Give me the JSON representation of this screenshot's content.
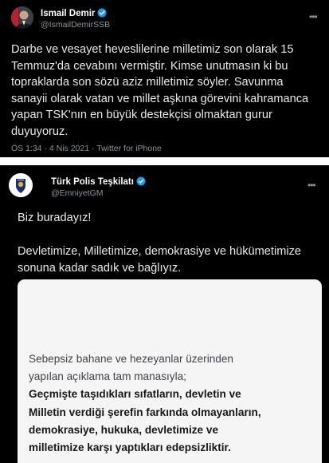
{
  "tweet1": {
    "author_name": "Ismail Demir",
    "handle": "@IsmailDemirSSB",
    "text_lines": [
      "Darbe ve vesayet heveslilerine milletimiz son olarak 15",
      "Temmuz'da cevabını vermiştir. Kimse unutmasın ki bu",
      "topraklarda son sözü aziz milletimiz söyler. Savunma",
      "sanayii olarak vatan ve millet aşkına görevini kahramanca",
      "yapan TSK'nın en büyük destekçisi olmaktan gurur",
      "duyuyoruz."
    ],
    "meta": "ÖS 1:34 · 4 Nis 2021 · Twitter for iPhone"
  },
  "tweet2": {
    "author_name": "Türk Polis Teşkilatı",
    "handle": "@EmniyetGM",
    "line1": "Biz buradayız!",
    "lines": [
      "Devletimize, Milletimize, demokrasiye ve hükümetimize",
      "sonuna kadar sadık ve bağlıyız."
    ],
    "card_regular_lines": [
      "Sebepsiz bahane ve hezeyanlar üzerinden",
      "yapılan açıklama tam manasıyla;"
    ],
    "card_bold_lines": [
      "Geçmişte taşıdıkları sıfatların, devletin ve",
      "Milletin verdiği şerefin farkında olmayanların,",
      "demokrasiye, hukuka, devletimize ve",
      "milletimize karşı yaptıkları edepsizliktir."
    ]
  },
  "colors": {
    "background": "#000000",
    "text": "#e9e9ea",
    "muted": "#8b949b",
    "verified": "#1d9bf0",
    "card": "#f5f5f6"
  },
  "icons": [
    "avatar-photo",
    "verified-badge-icon",
    "police-emblem-avatar",
    "more-options-icon"
  ]
}
